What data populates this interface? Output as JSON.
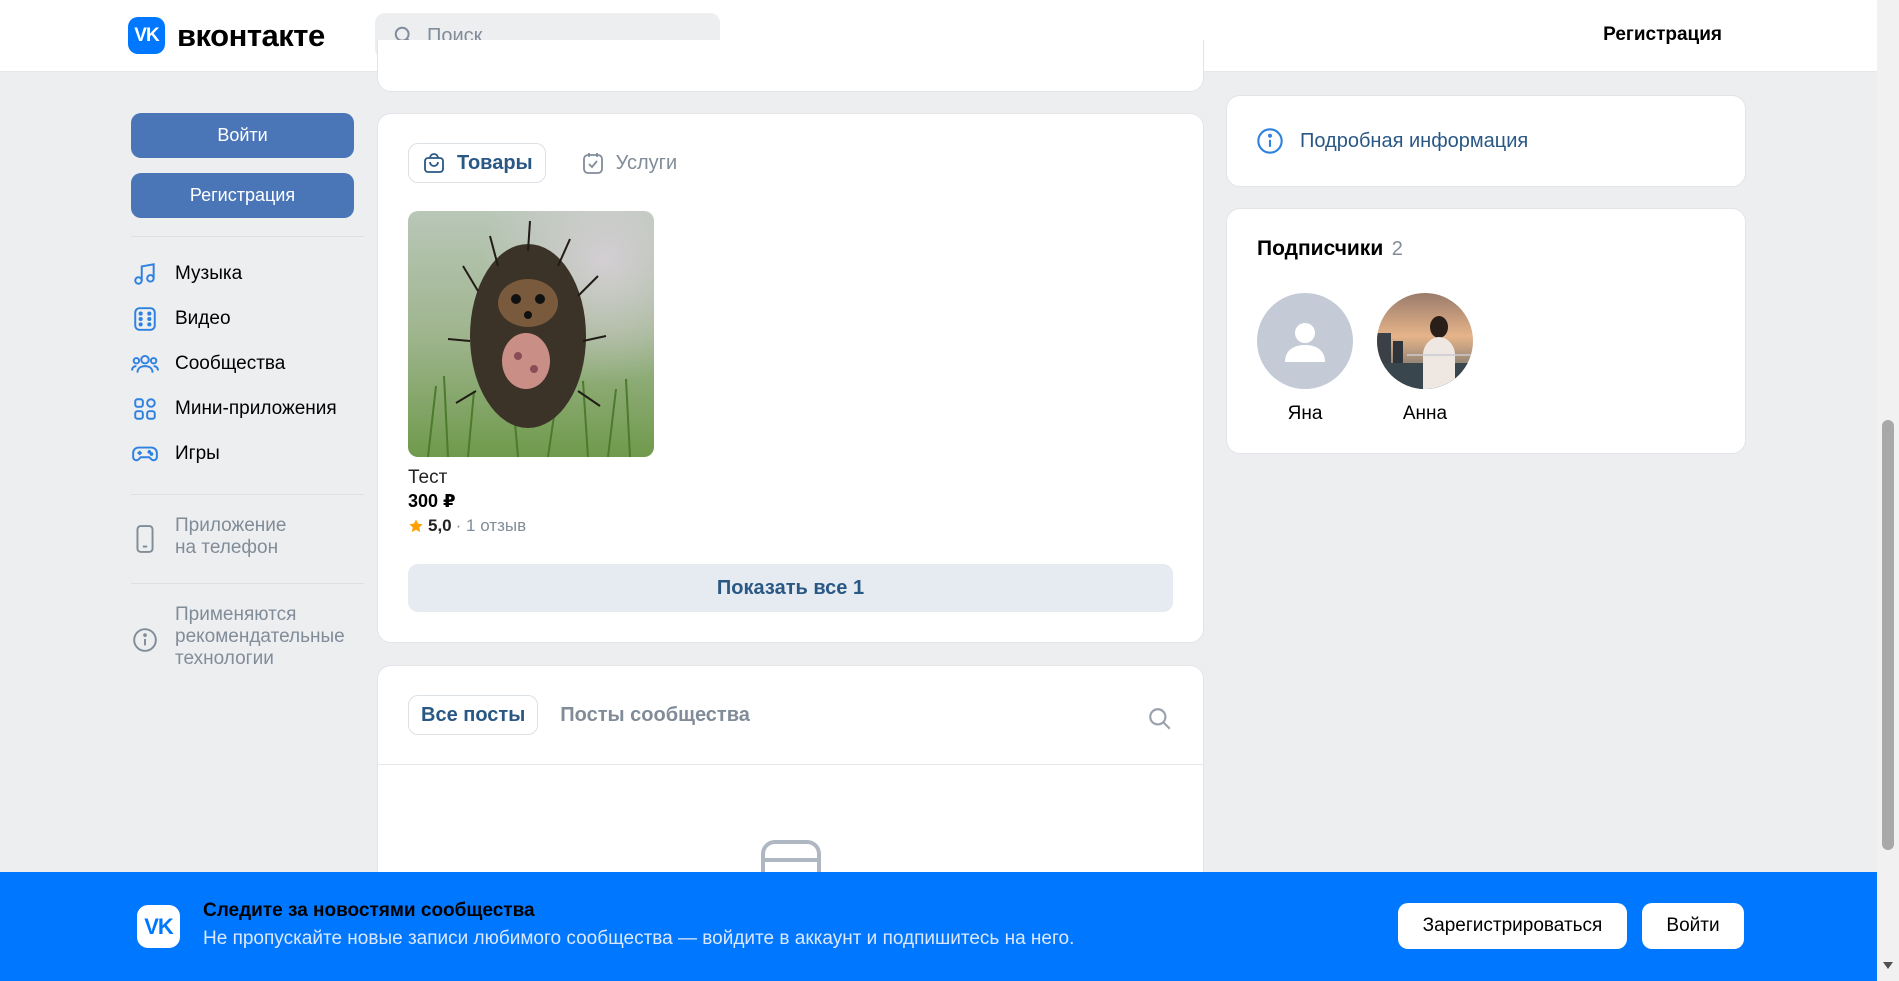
{
  "header": {
    "logo_glyph": "VK",
    "logo_text": "вконтакте",
    "search_placeholder": "Поиск",
    "register_link": "Регистрация"
  },
  "sidebar": {
    "login_button": "Войти",
    "register_button": "Регистрация",
    "nav": [
      {
        "label": "Музыка",
        "icon": "music-icon"
      },
      {
        "label": "Видео",
        "icon": "video-icon"
      },
      {
        "label": "Сообщества",
        "icon": "communities-icon"
      },
      {
        "label": "Мини-приложения",
        "icon": "mini-apps-icon"
      },
      {
        "label": "Игры",
        "icon": "games-icon"
      }
    ],
    "phone_app_line1": "Приложение",
    "phone_app_line2": "на телефон",
    "recommend_line1": "Применяются",
    "recommend_line2": "рекомендательные",
    "recommend_line3": "технологии"
  },
  "market": {
    "tabs": [
      {
        "label": "Товары",
        "active": true
      },
      {
        "label": "Услуги",
        "active": false
      }
    ],
    "product": {
      "name": "Тест",
      "price": "300 ₽",
      "rating": "5,0",
      "reviews": "· 1 отзыв"
    },
    "show_all": "Показать все 1"
  },
  "posts": {
    "tabs": [
      {
        "label": "Все посты",
        "active": true
      },
      {
        "label": "Посты сообщества",
        "active": false
      }
    ]
  },
  "info": {
    "details_link": "Подробная информация"
  },
  "subscribers": {
    "title": "Подписчики",
    "count": "2",
    "people": [
      {
        "name": "Яна"
      },
      {
        "name": "Анна"
      }
    ]
  },
  "banner": {
    "title": "Следите за новостями сообщества",
    "subtitle": "Не пропускайте новые записи любимого сообщества — войдите в аккаунт и подпишитесь на него.",
    "register_button": "Зарегистрироваться",
    "login_button": "Войти"
  },
  "colors": {
    "brand": "#0077ff",
    "button_blue": "#4a76b8",
    "link": "#2a5885",
    "muted": "#818c99"
  }
}
